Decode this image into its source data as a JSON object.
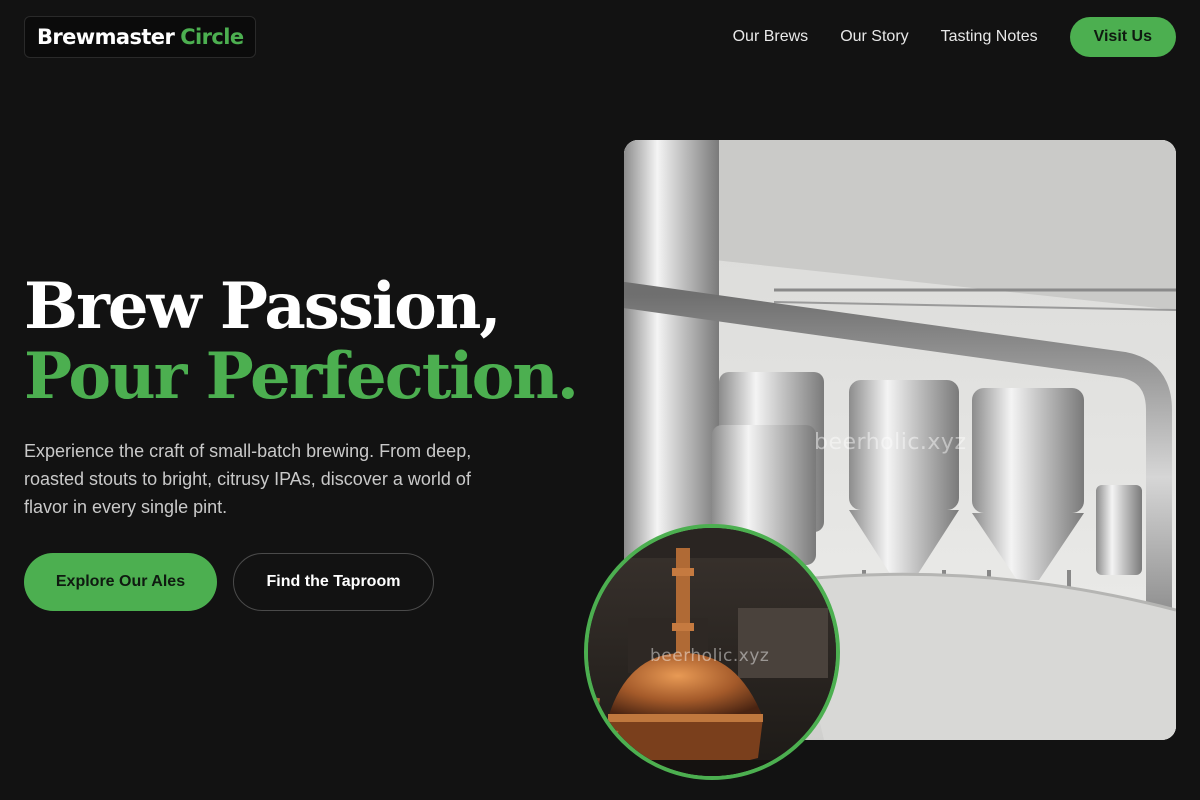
{
  "header": {
    "logo": {
      "primary": "Brewmaster",
      "accent": "Circle"
    },
    "nav": [
      {
        "label": "Our Brews"
      },
      {
        "label": "Our Story"
      },
      {
        "label": "Tasting Notes"
      }
    ],
    "cta_label": "Visit Us"
  },
  "hero": {
    "title_line1": "Brew Passion,",
    "title_line2": "Pour Perfection.",
    "description": "Experience the craft of small-batch brewing. From deep, roasted stouts to bright, citrusy IPAs, discover a world of flavor in every single pint.",
    "primary_button": "Explore Our Ales",
    "secondary_button": "Find the Taproom"
  },
  "images": {
    "main_watermark": "beerholic.xyz",
    "circle_watermark": "beerholic.xyz"
  },
  "colors": {
    "accent": "#4caf50",
    "background": "#121212",
    "text": "#ffffff",
    "muted_text": "#c9c9c9"
  }
}
